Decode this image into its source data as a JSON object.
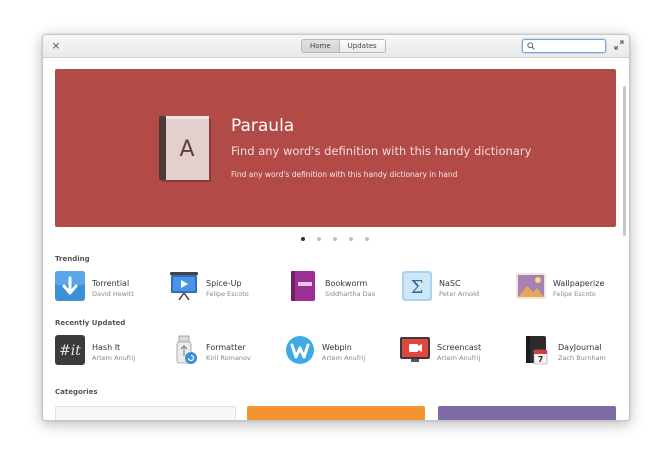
{
  "window": {
    "close_symbol": "×",
    "tabs": [
      {
        "label": "Home",
        "active": true
      },
      {
        "label": "Updates",
        "active": false
      }
    ],
    "search": {
      "value": "",
      "placeholder": ""
    }
  },
  "banner": {
    "title": "Paraula",
    "summary": "Find any word's definition with this handy dictionary",
    "description": "Find any word's definition with this handy dictionary in hand",
    "icon_letter": "A",
    "color": "#b24a48",
    "slide_count": 5,
    "active_slide": 1
  },
  "trending": {
    "label": "Trending",
    "apps": [
      {
        "name": "Torrential",
        "author": "David Hewitt",
        "icon": "torrential-icon"
      },
      {
        "name": "Spice-Up",
        "author": "Felipe Escoto",
        "icon": "spice-up-icon"
      },
      {
        "name": "Bookworm",
        "author": "Siddhartha Das",
        "icon": "bookworm-icon"
      },
      {
        "name": "NaSC",
        "author": "Peter Arnold",
        "icon": "nasc-icon"
      },
      {
        "name": "Wallpaperize",
        "author": "Felipe Escoto",
        "icon": "wallpaperize-icon"
      }
    ]
  },
  "recently_updated": {
    "label": "Recently Updated",
    "apps": [
      {
        "name": "Hash It",
        "author": "Artem Anufrij",
        "icon": "hash-it-icon",
        "icon_text": "#it"
      },
      {
        "name": "Formatter",
        "author": "Kiril Romanov",
        "icon": "formatter-icon"
      },
      {
        "name": "Webpin",
        "author": "Artem Anufrij",
        "icon": "webpin-icon"
      },
      {
        "name": "Screencast",
        "author": "Artem Anufrij",
        "icon": "screencast-icon"
      },
      {
        "name": "DayJournal",
        "author": "Zach Burnham",
        "icon": "dayjournal-icon",
        "icon_text": "7"
      }
    ]
  },
  "categories": {
    "label": "Categories",
    "colors": [
      "#f7f7f7",
      "#f59331",
      "#7f6ba5"
    ]
  }
}
